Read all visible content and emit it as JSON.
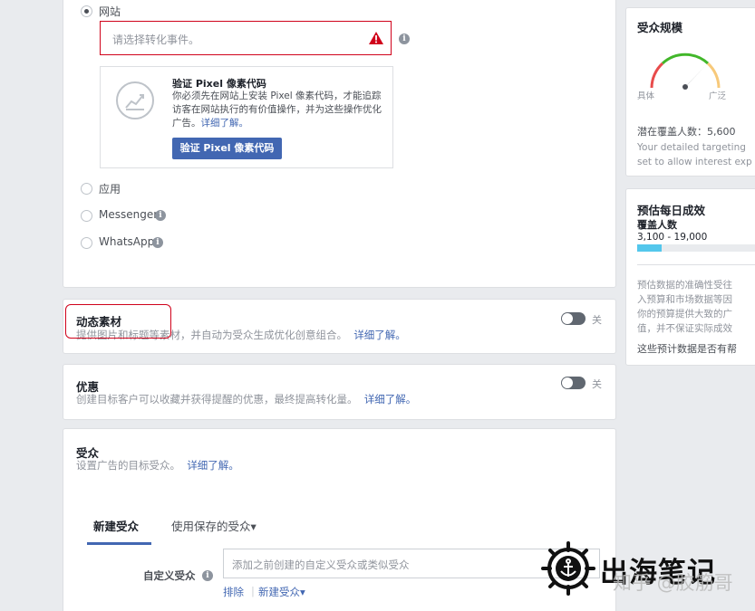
{
  "conversion": {
    "options": [
      {
        "label": "网站",
        "checked": true,
        "info": false
      },
      {
        "label": "应用",
        "checked": false,
        "info": false
      },
      {
        "label": "Messenger",
        "checked": false,
        "info": true
      },
      {
        "label": "WhatsApp",
        "checked": false,
        "info": true
      }
    ],
    "event_placeholder": "请选择转化事件。",
    "pixel": {
      "title": "验证 Pixel 像素代码",
      "desc": "你必须先在网站上安装 Pixel 像素代码，才能追踪访客在网站执行的有价值操作，并为这些操作优化广告。",
      "learn_more": "详细了解。",
      "button": "验证 Pixel 像素代码"
    }
  },
  "dynamic": {
    "title": "动态素材",
    "desc": "提供图片和标题等素材，并自动为受众生成优化创意组合。",
    "learn_more": "详细了解。",
    "toggle_label": "关"
  },
  "offer": {
    "title": "优惠",
    "desc": "创建目标客户可以收藏并获得提醒的优惠，最终提高转化量。",
    "learn_more": "详细了解。",
    "toggle_label": "关"
  },
  "audience": {
    "title": "受众",
    "desc": "设置广告的目标受众。",
    "learn_more": "详细了解。",
    "tabs": [
      "新建受众",
      "使用保存的受众"
    ],
    "tab_caret": "▾",
    "custom_label": "自定义受众",
    "custom_placeholder": "添加之前创建的自定义受众或类似受众",
    "exclude": "排除",
    "new_audience": "新建受众",
    "new_caret": "▾"
  },
  "audience_size": {
    "title": "受众规模",
    "left_label": "具体",
    "right_label": "广泛",
    "reach": "潜在覆盖人数：5,600",
    "note_1": "Your detailed targeting",
    "note_2": "set to allow interest exp"
  },
  "estimate": {
    "title": "预估每日成效",
    "reach_label": "覆盖人数",
    "range": "3,100 - 19,000",
    "bar_fraction": 0.2,
    "note_lines": [
      "预估数据的准确性受往",
      "入预算和市场数据等因",
      "你的预算提供大致的广",
      "值，并不保证实际成效"
    ],
    "link": "这些预计数据是否有帮"
  },
  "watermark": {
    "title": "出海笔记",
    "sub": "知乎 @胶筋哥"
  },
  "colors": {
    "accent": "#4267b2",
    "error": "#d0021b",
    "gauge_green": "#42b72a",
    "bar": "#54c7ec"
  }
}
